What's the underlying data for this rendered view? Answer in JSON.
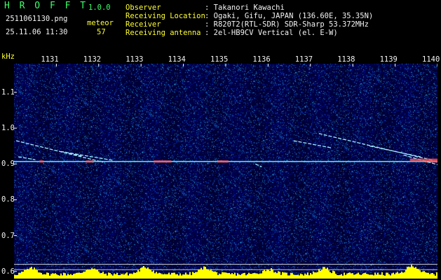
{
  "header": {
    "app_name": "H R O F F T",
    "version": "1.0.0",
    "filename": "2511061130.png",
    "datetime": "25.11.06 11:30",
    "meteor_label": "meteor",
    "meteor_count": "57",
    "info_labels": [
      "Observer",
      "Receiving Location",
      "Receiver",
      "Receiving antenna"
    ],
    "info_values": [
      ": Takanori Kawachi",
      ": Ogaki, Gifu, JAPAN (136.60E, 35.35N)",
      ": R820T2(RTL-SDR) SDR-Sharp 53.372MHz",
      ": 2el-HB9CV Vertical (el. E-W)"
    ]
  },
  "chart_data": {
    "type": "heatmap",
    "title": "",
    "xlabel": "",
    "ylabel": "kHz",
    "x_ticks": [
      "1131",
      "1132",
      "1133",
      "1134",
      "1135",
      "1136",
      "1137",
      "1138",
      "1139",
      "1140"
    ],
    "y_ticks": [
      "1.1",
      "1.0",
      "0.9",
      "0.8",
      "0.7",
      "0.6"
    ],
    "x_range": [
      1130,
      1140
    ],
    "y_range": [
      0.58,
      1.18
    ],
    "carrier_khz": 0.907,
    "reference_lines_khz": [
      0.62,
      0.605
    ],
    "meteor_traces": [
      {
        "x_start": 1130.05,
        "x_end": 1132.1,
        "khz_start": 0.965,
        "khz_end": 0.905
      },
      {
        "x_start": 1131.1,
        "x_end": 1132.35,
        "khz_start": 0.935,
        "khz_end": 0.91
      },
      {
        "x_start": 1137.2,
        "x_end": 1139.9,
        "khz_start": 0.985,
        "khz_end": 0.91
      },
      {
        "x_start": 1136.6,
        "x_end": 1137.5,
        "khz_start": 0.965,
        "khz_end": 0.945
      },
      {
        "x_start": 1138.4,
        "x_end": 1139.6,
        "khz_start": 0.95,
        "khz_end": 0.92
      },
      {
        "x_start": 1139.2,
        "x_end": 1140.0,
        "khz_start": 0.925,
        "khz_end": 0.898
      },
      {
        "x_start": 1130.1,
        "x_end": 1130.5,
        "khz_start": 0.92,
        "khz_end": 0.912
      },
      {
        "x_start": 1131.3,
        "x_end": 1131.6,
        "khz_start": 0.93,
        "khz_end": 0.922
      },
      {
        "x_start": 1135.7,
        "x_end": 1135.85,
        "khz_start": 0.9,
        "khz_end": 0.892
      }
    ],
    "colors": {
      "background": "#0a0a4a",
      "carrier": "#4fe6ff",
      "trace": "#9fe8ff",
      "hot": "#ff5a5a",
      "signal_bar": "#ffff00",
      "ref_line": "#c8c8c8"
    }
  }
}
